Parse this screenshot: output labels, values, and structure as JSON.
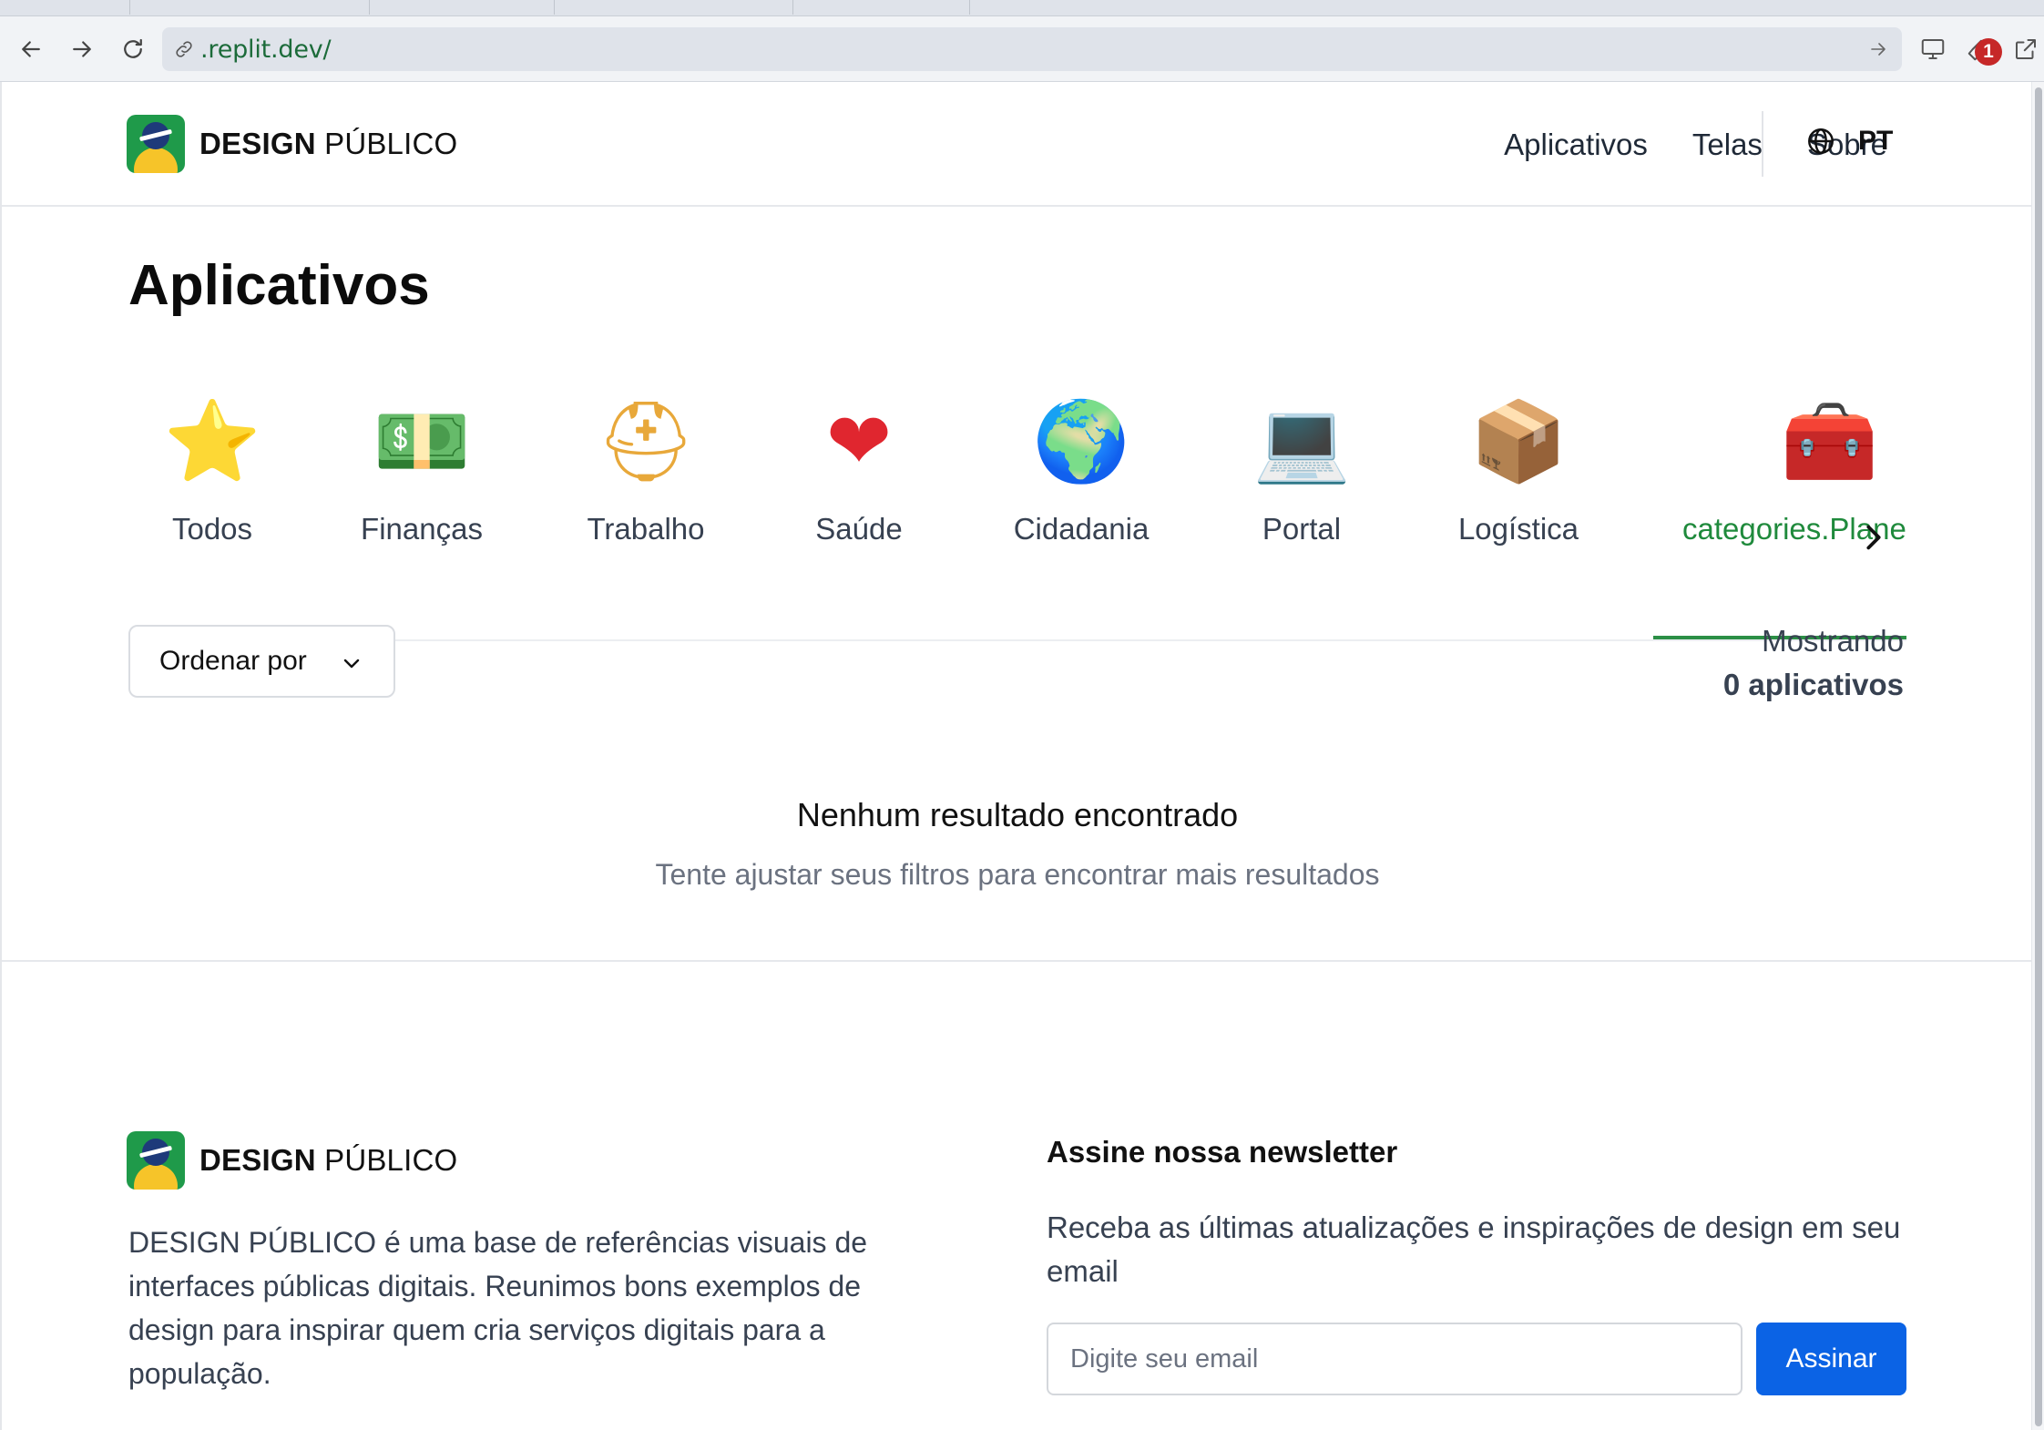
{
  "browser": {
    "url": ".replit.dev/",
    "notification_count": "1"
  },
  "header": {
    "logo": {
      "bold": "DESIGN",
      "rest": "PÚBLICO"
    },
    "nav": [
      "Aplicativos",
      "Telas",
      "Sobre"
    ],
    "language": "PT"
  },
  "page": {
    "title": "Aplicativos"
  },
  "categories": [
    {
      "label": "Todos",
      "icon": "⭐",
      "icon_name": "stars-icon",
      "active": false
    },
    {
      "label": "Finanças",
      "icon": "💵",
      "icon_name": "money-icon",
      "active": false
    },
    {
      "label": "Trabalho",
      "icon": "⛑",
      "icon_name": "hard-hat-icon",
      "active": false
    },
    {
      "label": "Saúde",
      "icon": "❤",
      "icon_name": "heart-icon",
      "active": false
    },
    {
      "label": "Cidadania",
      "icon": "🌍",
      "icon_name": "globe-icon",
      "active": false
    },
    {
      "label": "Portal",
      "icon": "💻",
      "icon_name": "laptop-icon",
      "active": false
    },
    {
      "label": "Logística",
      "icon": "📦",
      "icon_name": "hand-truck-icon",
      "active": false
    },
    {
      "label": "categories.Plane",
      "icon": "🧰",
      "icon_name": "toolbox-icon",
      "active": true
    }
  ],
  "filters": {
    "sort_label": "Ordenar por",
    "count_prefix": "Mostrando",
    "count_value": "0 aplicativos"
  },
  "empty_state": {
    "title": "Nenhum resultado encontrado",
    "subtitle": "Tente ajustar seus filtros para encontrar mais resultados"
  },
  "footer": {
    "logo": {
      "bold": "DESIGN",
      "rest": "PÚBLICO"
    },
    "description": "DESIGN PÚBLICO é uma base de referências visuais de interfaces públicas digitais. Reunimos bons exemplos de design para inspirar quem cria serviços digitais para a população.",
    "newsletter_title": "Assine nossa newsletter",
    "newsletter_desc": "Receba as últimas atualizações e inspirações de design em seu email",
    "email_placeholder": "Digite seu email",
    "subscribe_label": "Assinar"
  },
  "colors": {
    "accent_green": "#1f8a3c",
    "button_blue": "#0b63e5",
    "url_green": "#1c6b3a"
  }
}
